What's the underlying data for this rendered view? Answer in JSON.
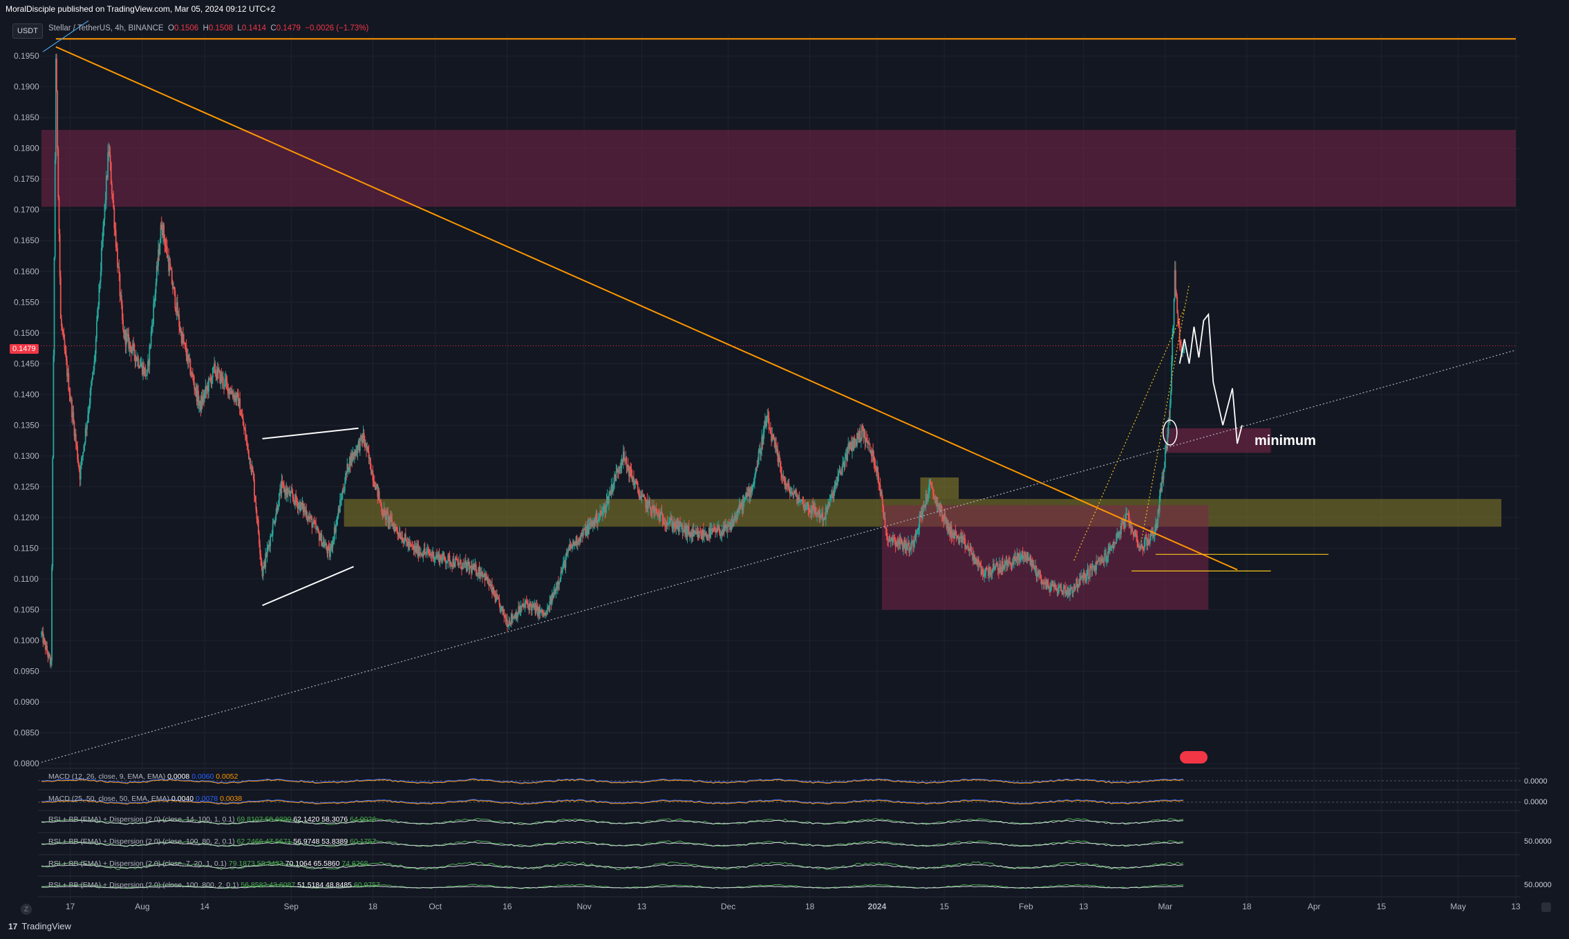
{
  "header": {
    "published": "MoralDisciple published on TradingView.com, Mar 05, 2024 09:12 UTC+2",
    "symbol_badge": "USDT",
    "title": "Stellar / TetherUS, 4h, BINANCE",
    "ohlc": {
      "o_label": "O",
      "o": "0.1506",
      "h_label": "H",
      "h": "0.1508",
      "l_label": "L",
      "l": "0.1414",
      "c_label": "C",
      "c": "0.1479",
      "change": "−0.0026 (−1.73%)"
    }
  },
  "branding": {
    "name": "TradingView",
    "logo": "17"
  },
  "last_price": "0.1479",
  "annotation_text": "minimum",
  "colors": {
    "background": "#131722",
    "up_candle": "#26a69a",
    "down_candle": "#ef5350",
    "trendline": "#ff9800",
    "supply_zone": "#8e2a5a",
    "yellow_zone": "#8a7f2a"
  },
  "indicators": [
    {
      "label": "MACD (12, 26, close, 9, EMA, EMA)",
      "v1": "0.0008",
      "v2": "0.0060",
      "v3": "0.0052",
      "axis": "0.0000"
    },
    {
      "label": "MACD (25, 50, close, 50, EMA, EMA)",
      "v1": "0.0040",
      "v2": "0.0078",
      "v3": "0.0038",
      "axis": "0.0000"
    },
    {
      "label": "RSI + BB (EMA) + Dispersion (2.0) (close, 14, 100, 1, 0.1)",
      "v1": "69.8107",
      "v2": "58.6390",
      "v3": "62.1420",
      "v4": "58.3076",
      "v5": "64.9026",
      "axis": ""
    },
    {
      "label": "RSI + BB (EMA) + Dispersion (2.0) (close, 100, 80, 2, 0.1)",
      "v1": "62.2466",
      "v2": "47.5671",
      "v3": "56.9748",
      "v4": "53.8389",
      "v5": "60.1757",
      "axis": "50.0000"
    },
    {
      "label": "RSI + BB (EMA) + Dispersion (2.0) (close, 7, 20, 1, 0.1)",
      "v1": "79.1873",
      "v2": "58.3433",
      "v3": "70.1064",
      "v4": "65.5860",
      "v5": "74.6268",
      "axis": ""
    },
    {
      "label": "RSI + BB (EMA) + Dispersion (2.0) (close, 100, 800, 2, 0.1)",
      "v1": "56.8582",
      "v2": "43.6087",
      "v3": "51.5184",
      "v4": "48.8485",
      "v5": "60.9757",
      "axis": "50.0000"
    }
  ],
  "chart_data": {
    "type": "candlestick",
    "title": "Stellar / TetherUS, 4h, BINANCE",
    "y_ticks": [
      "0.1950",
      "0.1900",
      "0.1850",
      "0.1800",
      "0.1750",
      "0.1700",
      "0.1650",
      "0.1600",
      "0.1550",
      "0.1500",
      "0.1450",
      "0.1400",
      "0.1350",
      "0.1300",
      "0.1250",
      "0.1200",
      "0.1150",
      "0.1100",
      "0.1050",
      "0.1000",
      "0.0950",
      "0.0900",
      "0.0850",
      "0.0800"
    ],
    "ylim": [
      0.08,
      0.1985
    ],
    "x_ticks": [
      "17",
      "Aug",
      "14",
      "Sep",
      "18",
      "Oct",
      "16",
      "Nov",
      "13",
      "Dec",
      "18",
      "2024",
      "15",
      "Feb",
      "13",
      "Mar",
      "18",
      "Apr",
      "15",
      "May",
      "13"
    ],
    "x_tick_dates": [
      "2023-07-17",
      "2023-08-01",
      "2023-08-14",
      "2023-09-01",
      "2023-09-18",
      "2023-10-01",
      "2023-10-16",
      "2023-11-01",
      "2023-11-13",
      "2023-12-01",
      "2023-12-18",
      "2024-01-01",
      "2024-01-15",
      "2024-02-01",
      "2024-02-13",
      "2024-03-01",
      "2024-03-18",
      "2024-04-01",
      "2024-04-15",
      "2024-05-01",
      "2024-05-13"
    ],
    "price_path": [
      [
        "2023-07-11",
        0.101
      ],
      [
        "2023-07-13",
        0.096
      ],
      [
        "2023-07-14",
        0.195
      ],
      [
        "2023-07-15",
        0.152
      ],
      [
        "2023-07-19",
        0.127
      ],
      [
        "2023-07-22",
        0.145
      ],
      [
        "2023-07-25",
        0.18
      ],
      [
        "2023-07-28",
        0.15
      ],
      [
        "2023-08-02",
        0.143
      ],
      [
        "2023-08-05",
        0.168
      ],
      [
        "2023-08-09",
        0.15
      ],
      [
        "2023-08-13",
        0.138
      ],
      [
        "2023-08-16",
        0.144
      ],
      [
        "2023-08-21",
        0.139
      ],
      [
        "2023-08-24",
        0.127
      ],
      [
        "2023-08-26",
        0.111
      ],
      [
        "2023-08-30",
        0.125
      ],
      [
        "2023-09-04",
        0.121
      ],
      [
        "2023-09-09",
        0.114
      ],
      [
        "2023-09-13",
        0.129
      ],
      [
        "2023-09-16",
        0.133
      ],
      [
        "2023-09-20",
        0.121
      ],
      [
        "2023-09-26",
        0.115
      ],
      [
        "2023-10-04",
        0.113
      ],
      [
        "2023-10-11",
        0.111
      ],
      [
        "2023-10-16",
        0.103
      ],
      [
        "2023-10-20",
        0.106
      ],
      [
        "2023-10-24",
        0.104
      ],
      [
        "2023-10-29",
        0.115
      ],
      [
        "2023-11-05",
        0.121
      ],
      [
        "2023-11-09",
        0.13
      ],
      [
        "2023-11-13",
        0.123
      ],
      [
        "2023-11-17",
        0.12
      ],
      [
        "2023-11-24",
        0.117
      ],
      [
        "2023-12-01",
        0.118
      ],
      [
        "2023-12-06",
        0.125
      ],
      [
        "2023-12-09",
        0.136
      ],
      [
        "2023-12-13",
        0.125
      ],
      [
        "2023-12-17",
        0.122
      ],
      [
        "2023-12-21",
        0.12
      ],
      [
        "2023-12-26",
        0.131
      ],
      [
        "2023-12-29",
        0.134
      ],
      [
        "2024-01-01",
        0.128
      ],
      [
        "2024-01-03",
        0.117
      ],
      [
        "2024-01-08",
        0.115
      ],
      [
        "2024-01-12",
        0.125
      ],
      [
        "2024-01-16",
        0.118
      ],
      [
        "2024-01-20",
        0.115
      ],
      [
        "2024-01-23",
        0.111
      ],
      [
        "2024-01-27",
        0.112
      ],
      [
        "2024-02-01",
        0.114
      ],
      [
        "2024-02-05",
        0.109
      ],
      [
        "2024-02-10",
        0.108
      ],
      [
        "2024-02-14",
        0.111
      ],
      [
        "2024-02-18",
        0.114
      ],
      [
        "2024-02-22",
        0.12
      ],
      [
        "2024-02-25",
        0.115
      ],
      [
        "2024-02-28",
        0.118
      ],
      [
        "2024-03-01",
        0.13
      ],
      [
        "2024-03-02",
        0.138
      ],
      [
        "2024-03-03",
        0.159
      ],
      [
        "2024-03-04",
        0.148
      ],
      [
        "2024-03-05",
        0.1479
      ]
    ],
    "last": {
      "o": 0.1506,
      "h": 0.1508,
      "l": 0.1414,
      "c": 0.1479
    },
    "zones": [
      {
        "name": "supply-zone-top",
        "from": "2023-07-11",
        "to": "2024-05-13",
        "high": 0.183,
        "low": 0.1705
      },
      {
        "name": "yellow-zone",
        "from": "2023-09-12",
        "to": "2024-05-10",
        "high": 0.123,
        "low": 0.1185
      },
      {
        "name": "demand-zone-lower",
        "from": "2024-01-02",
        "to": "2024-03-10",
        "high": 0.122,
        "low": 0.105
      },
      {
        "name": "target-zone",
        "from": "2024-03-01",
        "to": "2024-03-23",
        "high": 0.1345,
        "low": 0.1305
      }
    ],
    "lines": [
      {
        "name": "descending-trendline",
        "from": [
          "2023-07-14",
          0.1965
        ],
        "to": [
          "2024-03-16",
          0.1115
        ]
      },
      {
        "name": "horizontal-top",
        "from": [
          "2023-07-14",
          0.1978
        ],
        "to": [
          "2024-05-13",
          0.1978
        ]
      },
      {
        "name": "ascending-support",
        "from": [
          "2023-07-11",
          0.0802
        ],
        "to": [
          "2024-05-13",
          0.1472
        ]
      }
    ]
  }
}
